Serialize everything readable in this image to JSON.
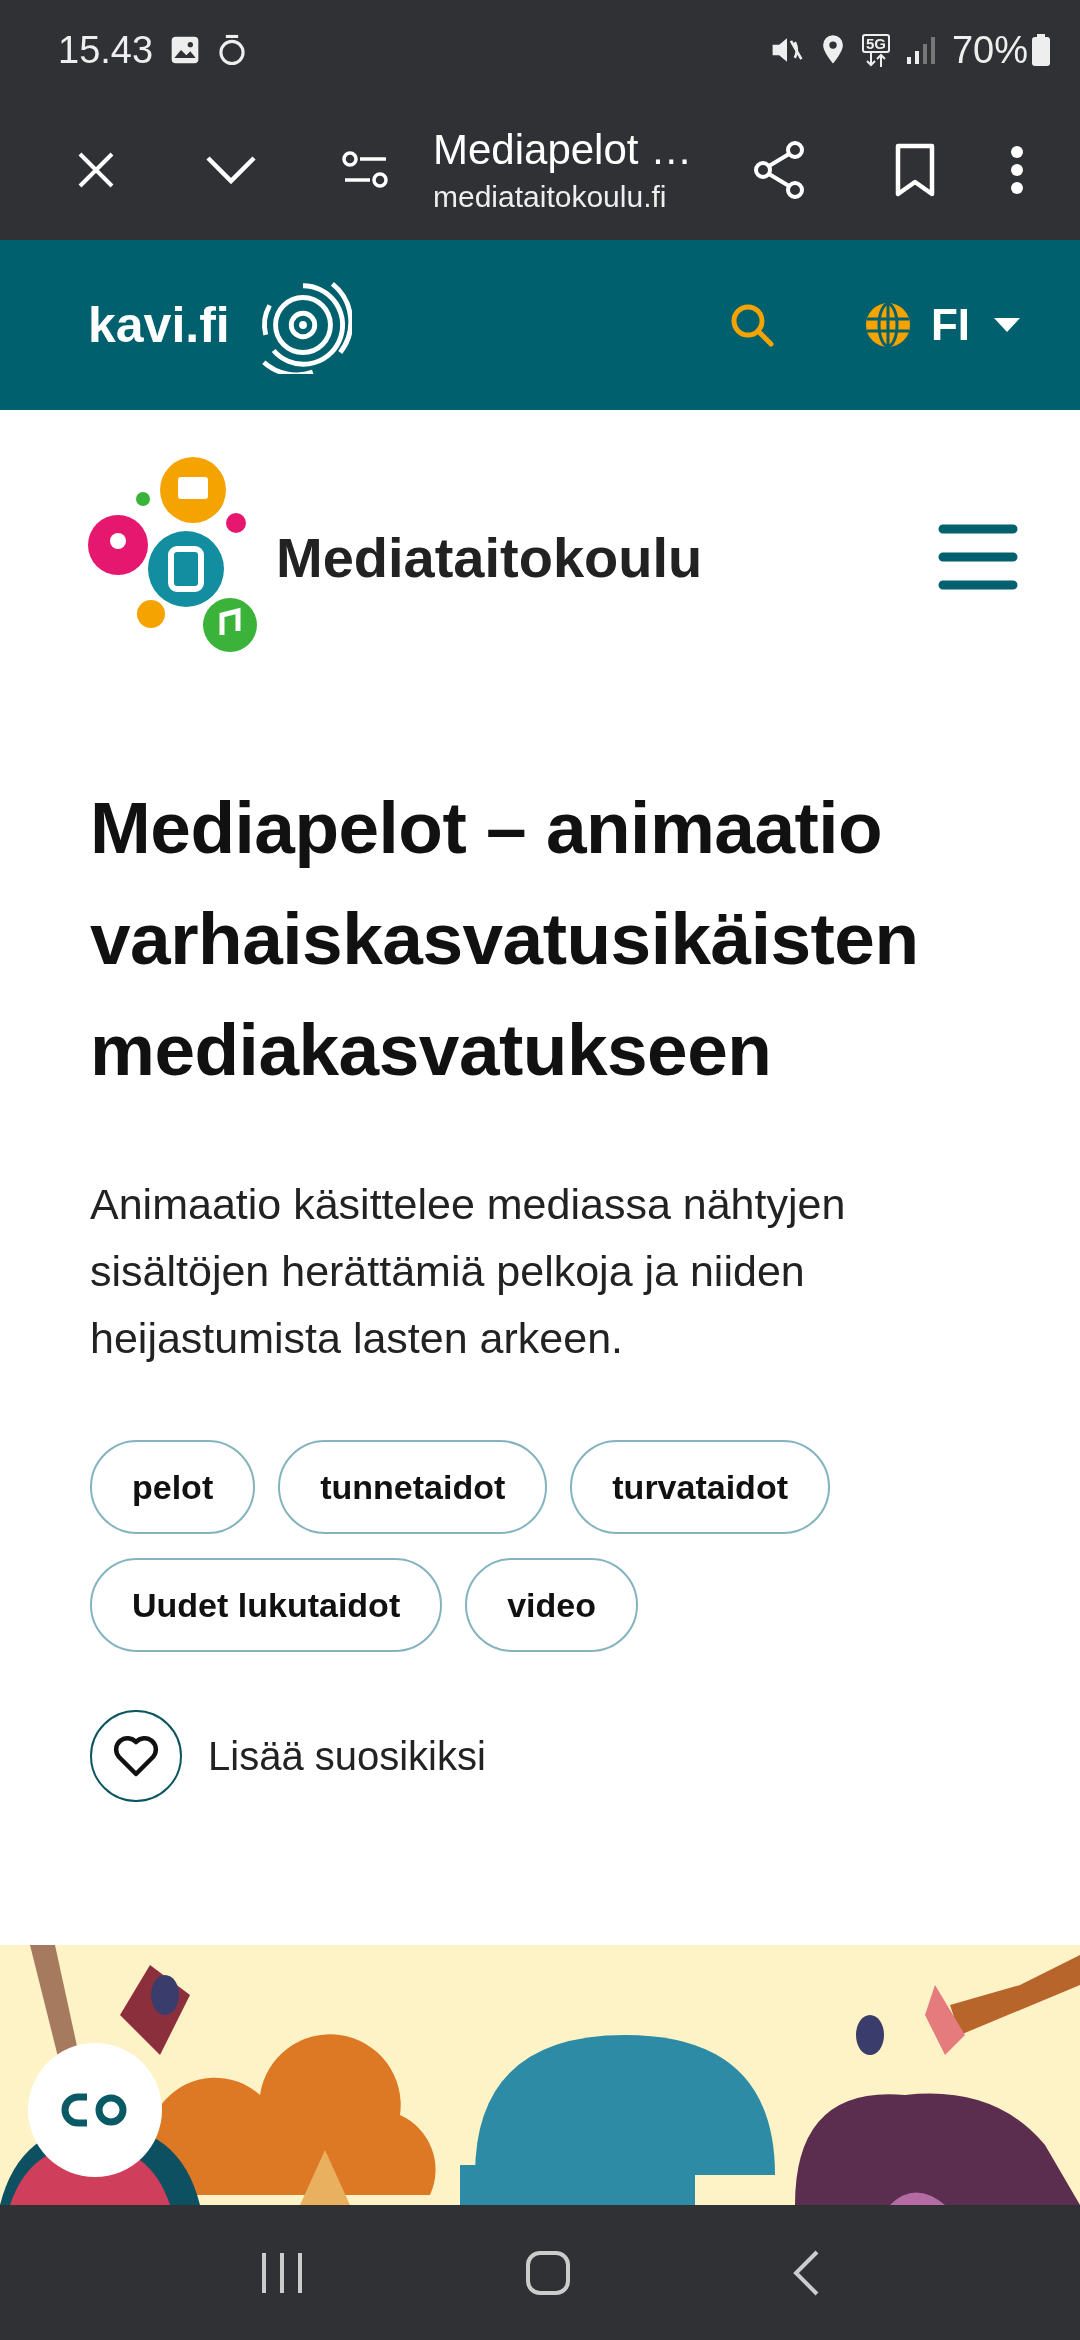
{
  "status_bar": {
    "time": "15.43",
    "network": "5G",
    "battery": "70%"
  },
  "browser": {
    "title": "Mediapelot …",
    "url": "mediataitokoulu.fi"
  },
  "site_header": {
    "brand": "kavi.fi",
    "language": "FI"
  },
  "site": {
    "name": "Mediataitokoulu"
  },
  "article": {
    "title": "Mediapelot – animaatio varhaiskasvatusikäisten mediakasvatukseen",
    "lead": "Animaatio käsittelee mediassa nähtyjen sisältöjen herättämiä pelkoja ja niiden heijastumista lasten arkeen.",
    "tags": [
      "pelot",
      "tunnetaidot",
      "turvataidot",
      "Uudet lukutaidot",
      "video"
    ],
    "favorite": {
      "label": "Lisää suosikiksi"
    }
  }
}
